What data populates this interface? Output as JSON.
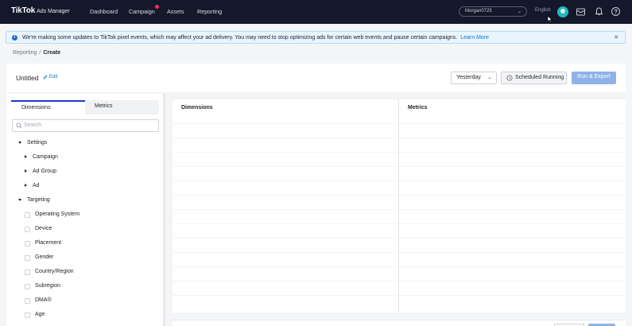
{
  "topnav": {
    "brand": "TikTok",
    "product": "Ads Manager",
    "items": [
      "Dashboard",
      "Campaign",
      "Assets",
      "Reporting"
    ],
    "account": "Morgan0725",
    "language": "English"
  },
  "notice": {
    "message": "We're making some updates to TikTok pixel events, which may affect your ad delivery. You may need to stop optimizing ads for certain web events and pause certain campaigns.",
    "link": "Learn More"
  },
  "breadcrumb": {
    "parent": "Reporting",
    "separator": "/",
    "current": "Create"
  },
  "header": {
    "title": "Untitled",
    "edit_label": "Edit",
    "date_range": "Yesterday",
    "scheduled_label": "Scheduled Running",
    "run_label": "Run & Export"
  },
  "left_panel": {
    "tabs": [
      "Dimensions",
      "Metrics"
    ],
    "search_placeholder": "Search",
    "settings_group": "Settings",
    "settings_items": [
      "Campaign",
      "Ad Group",
      "Ad"
    ],
    "targeting_group": "Targeting",
    "targeting_items": [
      "Operating System",
      "Device",
      "Placement",
      "Gender",
      "Country/Region",
      "Subregion",
      "DMA®",
      "Age"
    ]
  },
  "table": {
    "dimensions_header": "Dimensions",
    "metrics_header": "Metrics"
  },
  "colors": {
    "nav_bg": "#14182b",
    "accent": "#1a6ecd",
    "run_button": "#8fb2e8",
    "notice_bg": "#e8f5ff"
  }
}
